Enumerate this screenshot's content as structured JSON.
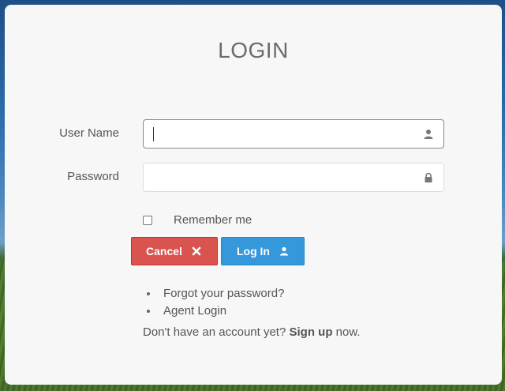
{
  "form": {
    "title": "LOGIN",
    "username_label": "User Name",
    "username_value": "",
    "password_label": "Password",
    "password_value": "",
    "remember_label": "Remember me",
    "remember_checked": false,
    "cancel_label": "Cancel",
    "login_label": "Log In"
  },
  "links": {
    "items": [
      {
        "label": "Forgot your password?"
      },
      {
        "label": "Agent Login"
      }
    ],
    "signup_prefix": "Don't have an account yet?",
    "signup_link": "Sign up",
    "signup_suffix": "now."
  },
  "icons": {
    "username_field": "user-icon",
    "password_field": "lock-icon",
    "cancel_button": "times-icon",
    "login_button": "user-icon"
  },
  "colors": {
    "cancel": "#d9534f",
    "login": "#3498db",
    "card": "#f7f7f7"
  }
}
